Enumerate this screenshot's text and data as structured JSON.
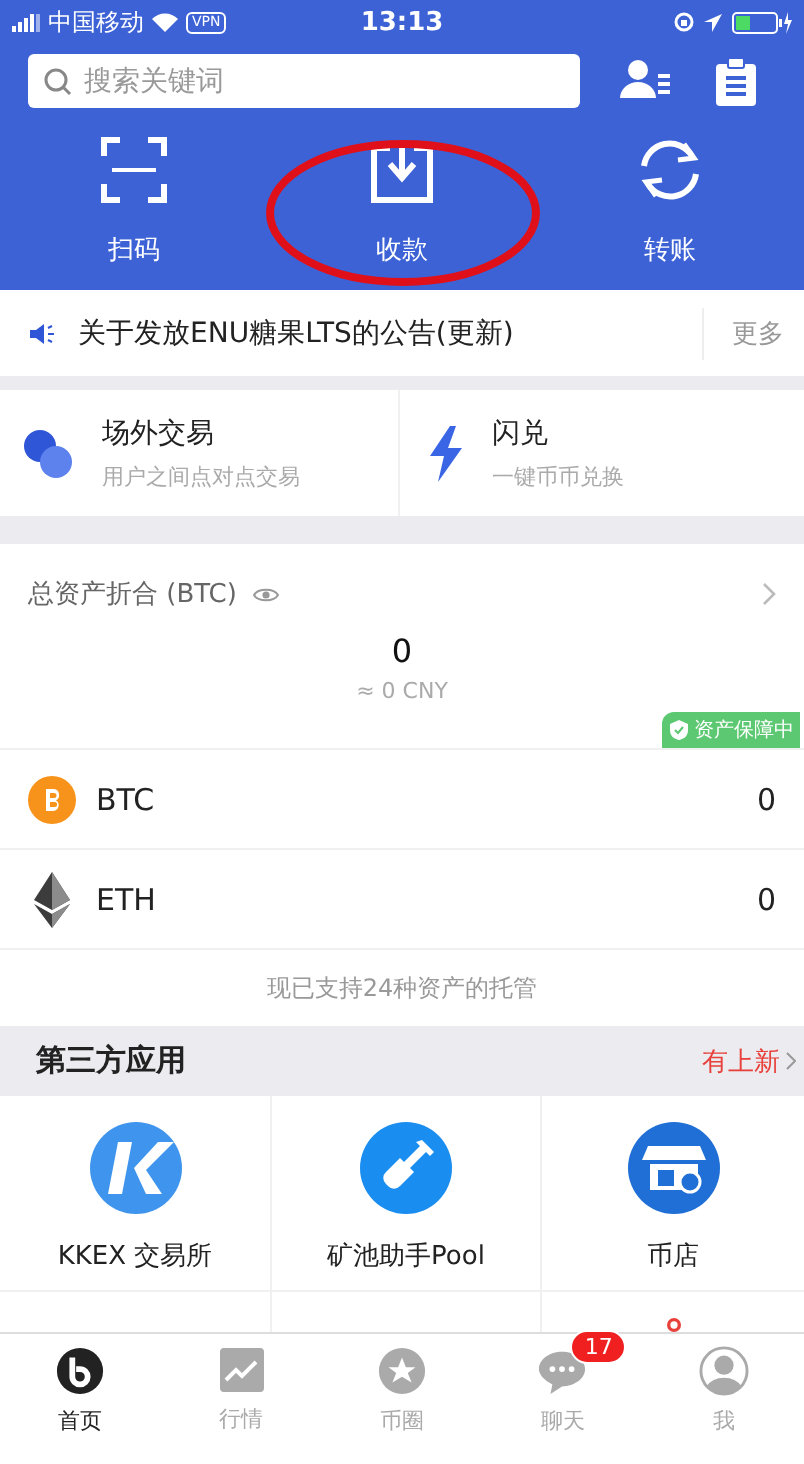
{
  "status_bar": {
    "carrier": "中国移动",
    "vpn": "VPN",
    "time": "13:13"
  },
  "search": {
    "placeholder": "搜索关键词"
  },
  "actions": [
    {
      "label": "扫码",
      "kind": "scan",
      "circled": false
    },
    {
      "label": "收款",
      "kind": "receive",
      "circled": true
    },
    {
      "label": "转账",
      "kind": "transfer",
      "circled": false
    }
  ],
  "notice": {
    "text": "关于发放ENU糖果LTS的公告(更新)",
    "more": "更多"
  },
  "services": [
    {
      "title": "场外交易",
      "subtitle": "用户之间点对点交易",
      "kind": "otc"
    },
    {
      "title": "闪兑",
      "subtitle": "一键币币兑换",
      "kind": "flash"
    }
  ],
  "assets": {
    "label": "总资产折合 (BTC)",
    "total": "0",
    "cny": "≈ 0 CNY",
    "badge": "资产保障中",
    "coins": [
      {
        "symbol": "BTC",
        "amount": "0",
        "kind": "btc"
      },
      {
        "symbol": "ETH",
        "amount": "0",
        "kind": "eth"
      }
    ],
    "footer": "现已支持24种资产的托管"
  },
  "third_party": {
    "title": "第三方应用",
    "link": "有上新",
    "apps": [
      {
        "label": "KKEX 交易所",
        "kind": "kkex"
      },
      {
        "label": "矿池助手Pool",
        "kind": "shovel"
      },
      {
        "label": "币店",
        "kind": "shop"
      },
      {
        "kind": "blank"
      },
      {
        "kind": "blank"
      },
      {
        "kind": "red"
      }
    ]
  },
  "tabs": [
    {
      "label": "首页",
      "kind": "home",
      "selected": true
    },
    {
      "label": "行情",
      "kind": "chart",
      "selected": false
    },
    {
      "label": "币圈",
      "kind": "star",
      "selected": false
    },
    {
      "label": "聊天",
      "kind": "chat",
      "selected": false,
      "badge": "17"
    },
    {
      "label": "我",
      "kind": "user",
      "selected": false
    }
  ]
}
